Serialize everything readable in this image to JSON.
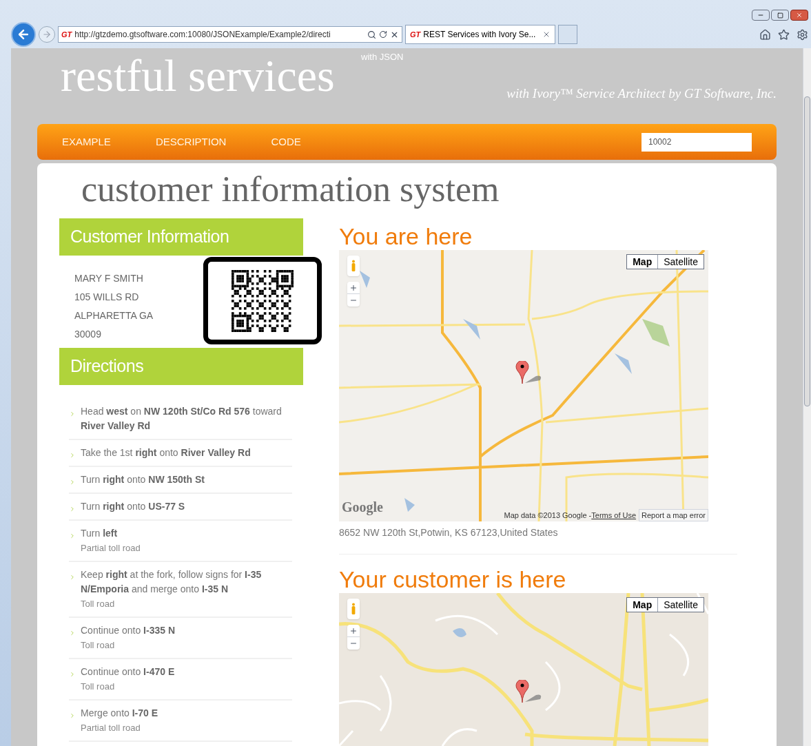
{
  "browser": {
    "favicon": "GT",
    "url": "http://gtzdemo.gtsoftware.com:10080/JSONExample/Example2/directi",
    "tabs": [
      {
        "favicon": "GT",
        "label": "REST Services with Ivory Se...",
        "selected": true
      }
    ]
  },
  "header": {
    "title": "restful services",
    "superscript": "with JSON",
    "tagline": "with Ivory™ Service Architect by GT Software, Inc."
  },
  "nav": {
    "items": [
      {
        "label": "EXAMPLE",
        "selected": false
      },
      {
        "label": "DESCRIPTION",
        "selected": false
      },
      {
        "label": "CODE",
        "selected": false
      }
    ],
    "search": {
      "value": "10002"
    }
  },
  "page_title": "customer information system",
  "customer": {
    "heading": "Customer Information",
    "lines": [
      "MARY F SMITH",
      "105 WILLS RD",
      "ALPHARETTA GA",
      "30009"
    ]
  },
  "directions": {
    "heading": "Directions",
    "steps": [
      {
        "text": "Head **west** on **NW 120th St/Co Rd 576** toward **River Valley Rd**"
      },
      {
        "text": "Take the 1st **right** onto **River Valley Rd**"
      },
      {
        "text": "Turn **right** onto **NW 150th St**"
      },
      {
        "text": "Turn **right** onto **US-77 S**"
      },
      {
        "text": "Turn **left**",
        "note": "Partial toll road"
      },
      {
        "text": "Keep **right** at the fork, follow signs for **I-35 N/Emporia** and merge onto **I-35 N**",
        "note": "Toll road"
      },
      {
        "text": "Continue onto **I-335 N**",
        "note": "Toll road"
      },
      {
        "text": "Continue onto **I-470 E**",
        "note": "Toll road"
      },
      {
        "text": "Merge onto **I-70 E**",
        "note": "Partial toll road"
      }
    ]
  },
  "maps": [
    {
      "heading": "You are here",
      "kind": "region",
      "types": [
        {
          "label": "Map",
          "selected": true
        },
        {
          "label": "Satellite",
          "selected": false
        }
      ],
      "logo": "Google",
      "attribution": "Map data ©2013 Google - ",
      "terms": "Terms of Use",
      "report": "Report a map error",
      "address": "8652 NW 120th St,Potwin, KS 67123,United States"
    },
    {
      "heading": "Your customer is here",
      "kind": "street",
      "types": [
        {
          "label": "Map",
          "selected": true
        },
        {
          "label": "Satellite",
          "selected": false
        }
      ]
    }
  ]
}
